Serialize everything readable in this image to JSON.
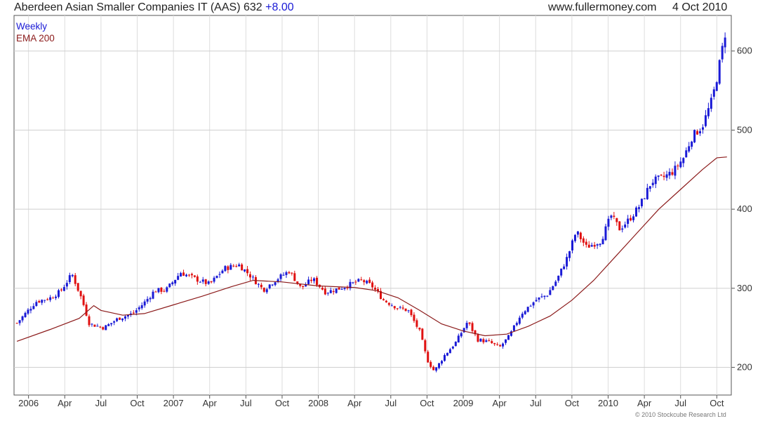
{
  "header": {
    "title": "Aberdeen Asian Smaller Companies IT (AAS) 632",
    "change": "+8.00",
    "site": "www.fullermoney.com",
    "date": "4 Oct 2010"
  },
  "legend": {
    "weekly": "Weekly",
    "ema": "EMA 200"
  },
  "credit": "© 2010 Stockcube Research Ltd",
  "colors": {
    "up": "#1a1ad6",
    "down": "#e01010",
    "ema": "#8b1a1a",
    "grid": "#dddddd",
    "axis": "#555555"
  },
  "chart_data": {
    "type": "candlestick",
    "interval": "weekly",
    "x_ticks": [
      "2006",
      "Apr",
      "Jul",
      "Oct",
      "2007",
      "Apr",
      "Jul",
      "Oct",
      "2008",
      "Apr",
      "Jul",
      "Oct",
      "2009",
      "Apr",
      "Jul",
      "Oct",
      "2010",
      "Apr",
      "Jul",
      "Oct"
    ],
    "y_ticks": [
      200,
      300,
      400,
      500,
      600
    ],
    "ylim": [
      165,
      645
    ],
    "grid": true,
    "legend_position": "top-left",
    "close_series": [
      [
        2005.92,
        256
      ],
      [
        2006.05,
        283
      ],
      [
        2006.15,
        288
      ],
      [
        2006.22,
        296
      ],
      [
        2006.3,
        318
      ],
      [
        2006.37,
        285
      ],
      [
        2006.42,
        255
      ],
      [
        2006.52,
        250
      ],
      [
        2006.62,
        262
      ],
      [
        2006.72,
        268
      ],
      [
        2006.8,
        282
      ],
      [
        2006.87,
        297
      ],
      [
        2006.95,
        298
      ],
      [
        2007.05,
        320
      ],
      [
        2007.15,
        312
      ],
      [
        2007.25,
        305
      ],
      [
        2007.35,
        325
      ],
      [
        2007.45,
        330
      ],
      [
        2007.52,
        318
      ],
      [
        2007.62,
        298
      ],
      [
        2007.7,
        310
      ],
      [
        2007.8,
        322
      ],
      [
        2007.88,
        300
      ],
      [
        2007.96,
        312
      ],
      [
        2008.05,
        295
      ],
      [
        2008.15,
        300
      ],
      [
        2008.22,
        305
      ],
      [
        2008.3,
        310
      ],
      [
        2008.37,
        303
      ],
      [
        2008.45,
        285
      ],
      [
        2008.55,
        275
      ],
      [
        2008.62,
        272
      ],
      [
        2008.7,
        245
      ],
      [
        2008.75,
        210
      ],
      [
        2008.8,
        195
      ],
      [
        2008.87,
        215
      ],
      [
        2008.95,
        232
      ],
      [
        2009.03,
        258
      ],
      [
        2009.1,
        235
      ],
      [
        2009.18,
        232
      ],
      [
        2009.25,
        225
      ],
      [
        2009.32,
        240
      ],
      [
        2009.4,
        268
      ],
      [
        2009.5,
        285
      ],
      [
        2009.58,
        292
      ],
      [
        2009.65,
        312
      ],
      [
        2009.72,
        340
      ],
      [
        2009.78,
        372
      ],
      [
        2009.85,
        352
      ],
      [
        2009.95,
        360
      ],
      [
        2010.02,
        392
      ],
      [
        2010.08,
        375
      ],
      [
        2010.15,
        388
      ],
      [
        2010.22,
        405
      ],
      [
        2010.3,
        435
      ],
      [
        2010.38,
        440
      ],
      [
        2010.45,
        448
      ],
      [
        2010.52,
        465
      ],
      [
        2010.58,
        492
      ],
      [
        2010.65,
        505
      ],
      [
        2010.72,
        540
      ],
      [
        2010.76,
        575
      ],
      [
        2010.79,
        605
      ],
      [
        2010.81,
        625
      ],
      [
        2010.82,
        632
      ]
    ],
    "ema_series": [
      [
        2005.92,
        233
      ],
      [
        2006.15,
        248
      ],
      [
        2006.35,
        262
      ],
      [
        2006.45,
        278
      ],
      [
        2006.5,
        272
      ],
      [
        2006.65,
        266
      ],
      [
        2006.8,
        268
      ],
      [
        2007.0,
        279
      ],
      [
        2007.2,
        290
      ],
      [
        2007.4,
        302
      ],
      [
        2007.55,
        310
      ],
      [
        2007.75,
        308
      ],
      [
        2008.0,
        303
      ],
      [
        2008.25,
        301
      ],
      [
        2008.4,
        297
      ],
      [
        2008.55,
        288
      ],
      [
        2008.7,
        272
      ],
      [
        2008.85,
        255
      ],
      [
        2009.0,
        246
      ],
      [
        2009.15,
        240
      ],
      [
        2009.3,
        242
      ],
      [
        2009.45,
        252
      ],
      [
        2009.6,
        265
      ],
      [
        2009.75,
        285
      ],
      [
        2009.9,
        310
      ],
      [
        2010.05,
        340
      ],
      [
        2010.2,
        370
      ],
      [
        2010.35,
        400
      ],
      [
        2010.5,
        425
      ],
      [
        2010.65,
        450
      ],
      [
        2010.75,
        465
      ],
      [
        2010.82,
        466
      ]
    ]
  }
}
